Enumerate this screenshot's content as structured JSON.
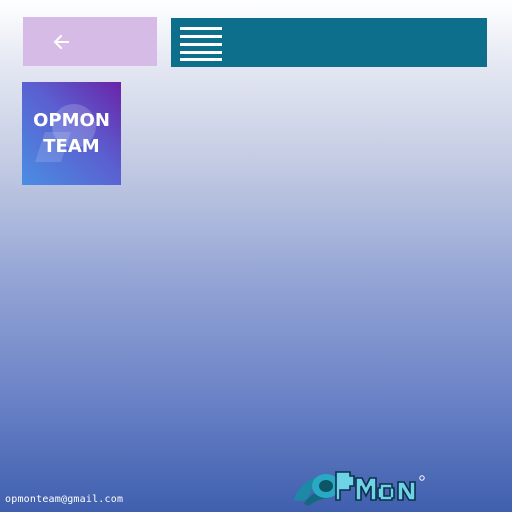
{
  "navigation": {
    "back_icon": "arrow-left-icon",
    "menu_icon": "hamburger-menu-icon"
  },
  "team_logo": {
    "text": "OPMON\nTEAM"
  },
  "footer": {
    "email": "opmonteam@gmail.com",
    "brand_logo_text": "OPMon"
  },
  "colors": {
    "back_button": "#d5bbe6",
    "menu_bar": "#0d6f8c",
    "background_top": "#ffffff",
    "background_bottom": "#3f5fae"
  }
}
